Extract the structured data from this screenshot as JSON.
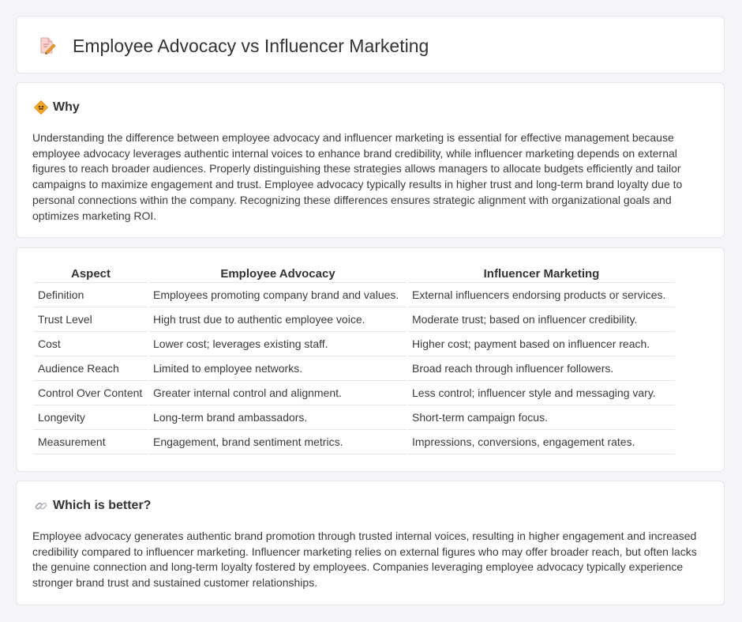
{
  "header": {
    "title": "Employee Advocacy vs Influencer Marketing",
    "icon": "document-pencil-icon"
  },
  "why": {
    "title": "Why",
    "icon": "diamond-sign-icon",
    "text": "Understanding the difference between employee advocacy and influencer marketing is essential for effective management because employee advocacy leverages authentic internal voices to enhance brand credibility, while influencer marketing depends on external figures to reach broader audiences. Properly distinguishing these strategies allows managers to allocate budgets efficiently and tailor campaigns to maximize engagement and trust. Employee advocacy typically results in higher trust and long-term brand loyalty due to personal connections within the company. Recognizing these differences ensures strategic alignment with organizational goals and optimizes marketing ROI."
  },
  "table": {
    "headers": [
      "Aspect",
      "Employee Advocacy",
      "Influencer Marketing"
    ],
    "rows": [
      [
        "Definition",
        "Employees promoting company brand and values.",
        "External influencers endorsing products or services."
      ],
      [
        "Trust Level",
        "High trust due to authentic employee voice.",
        "Moderate trust; based on influencer credibility."
      ],
      [
        "Cost",
        "Lower cost; leverages existing staff.",
        "Higher cost; payment based on influencer reach."
      ],
      [
        "Audience Reach",
        "Limited to employee networks.",
        "Broad reach through influencer followers."
      ],
      [
        "Control Over Content",
        "Greater internal control and alignment.",
        "Less control; influencer style and messaging vary."
      ],
      [
        "Longevity",
        "Long-term brand ambassadors.",
        "Short-term campaign focus."
      ],
      [
        "Measurement",
        "Engagement, brand sentiment metrics.",
        "Impressions, conversions, engagement rates."
      ]
    ]
  },
  "better": {
    "title": "Which is better?",
    "icon": "link-icon",
    "text": "Employee advocacy generates authentic brand promotion through trusted internal voices, resulting in higher engagement and increased credibility compared to influencer marketing. Influencer marketing relies on external figures who may offer broader reach, but often lacks the genuine connection and long-term loyalty fostered by employees. Companies leveraging employee advocacy typically experience stronger brand trust and sustained customer relationships."
  },
  "colors": {
    "background": "#f4f5f9",
    "card": "#ffffff",
    "border": "#e3e5ec",
    "text": "#333333",
    "icon_accent": "#f0a030"
  }
}
